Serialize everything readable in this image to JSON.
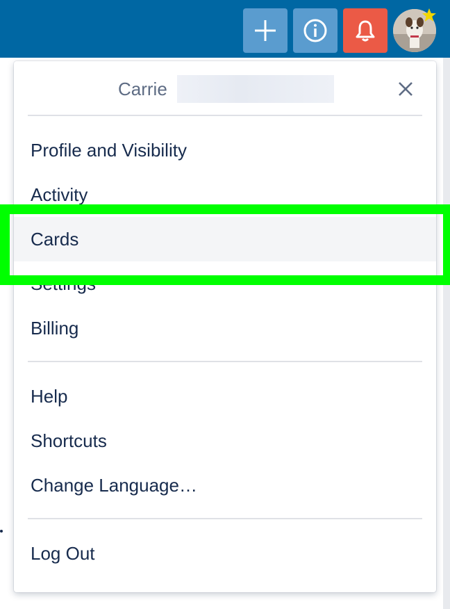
{
  "header": {
    "add_button": "add-icon",
    "info_button": "info-icon",
    "notifications_button": "bell-icon",
    "avatar": "avatar-image",
    "colors": {
      "bar": "#0067a3",
      "button": "#5a9ccf",
      "bell_button": "#eb5a46"
    }
  },
  "popover": {
    "title": "Carrie",
    "close_icon": "close-icon",
    "sections": [
      {
        "items": [
          {
            "label": "Profile and Visibility"
          },
          {
            "label": "Activity"
          },
          {
            "label": "Cards"
          },
          {
            "label": "Settings"
          },
          {
            "label": "Billing"
          }
        ]
      },
      {
        "items": [
          {
            "label": "Help"
          },
          {
            "label": "Shortcuts"
          },
          {
            "label": "Change Language…"
          }
        ]
      },
      {
        "items": [
          {
            "label": "Log Out"
          }
        ]
      }
    ],
    "highlight_color": "#00ff00"
  }
}
